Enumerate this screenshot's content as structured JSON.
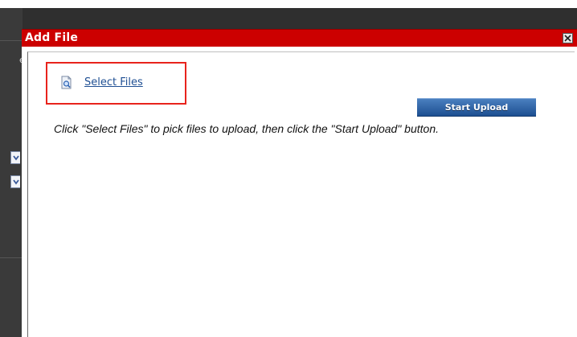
{
  "background": {
    "side_char": "e"
  },
  "dialog": {
    "title": "Add File",
    "close_icon": "close-x-icon",
    "select_files_label": "Select Files",
    "select_files_icon": "document-search-icon",
    "start_upload_label": "Start Upload",
    "instructions": "Click \"Select Files\" to pick files to upload, then click the \"Start Upload\" button."
  },
  "colors": {
    "titlebar": "#cc0000",
    "highlight_border": "#e8231c",
    "link": "#1f4f93",
    "upload_button": "#1d4f91"
  }
}
